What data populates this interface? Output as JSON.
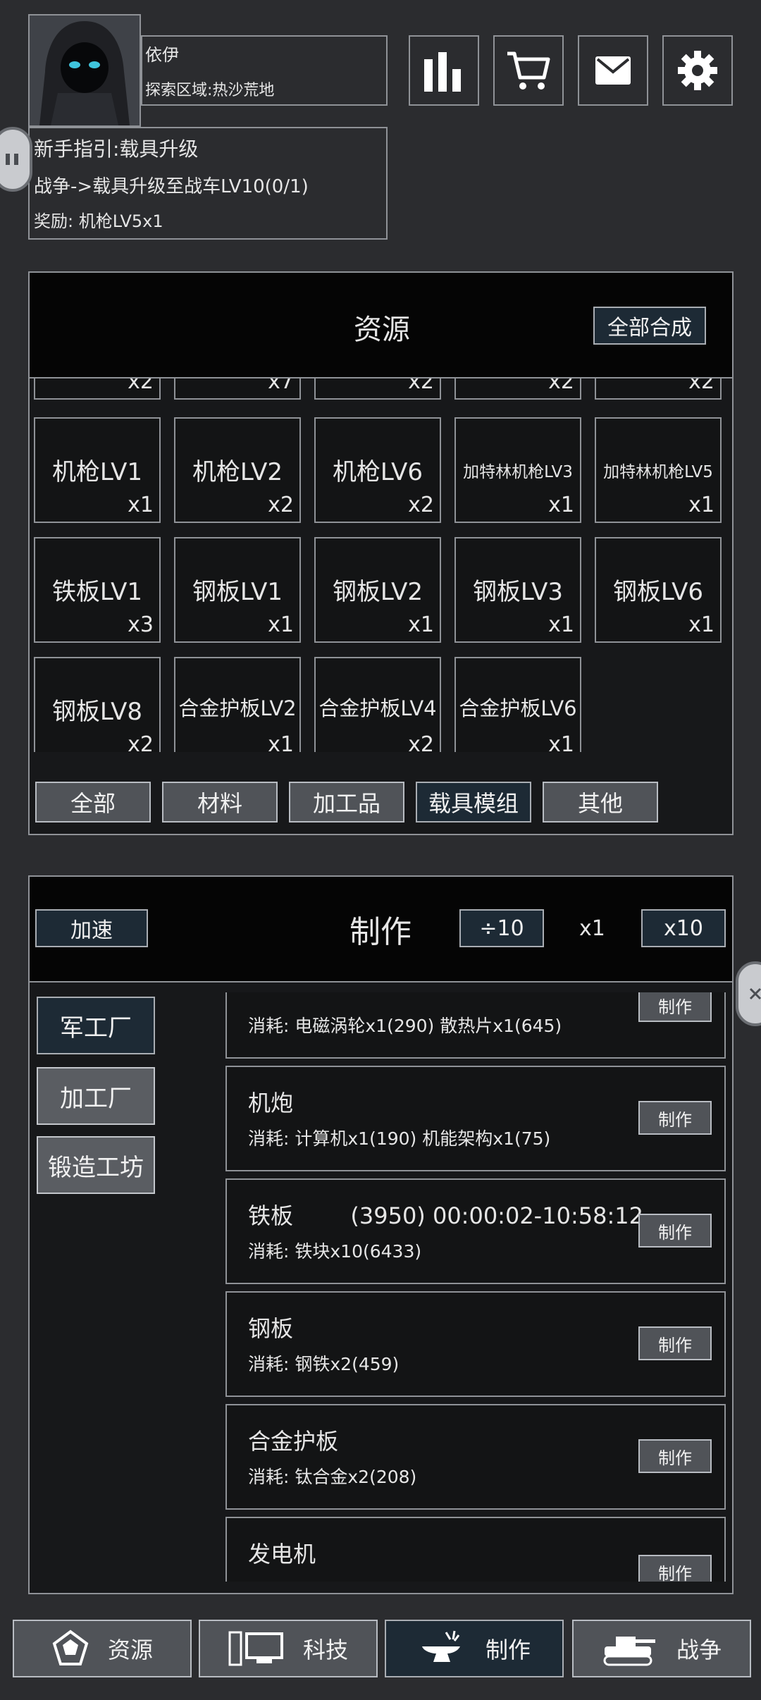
{
  "player": {
    "name": "依伊",
    "zone": "探索区域:热沙荒地"
  },
  "guide": {
    "title": "新手指引:载具升级",
    "task": "战争->载具升级至战车LV10(0/1)",
    "reward": "奖励: 机枪LV5x1"
  },
  "top_buttons": [
    {
      "icon": "bar-chart-icon"
    },
    {
      "icon": "cart-icon"
    },
    {
      "icon": "mail-icon"
    },
    {
      "icon": "gear-icon"
    }
  ],
  "resources": {
    "title": "资源",
    "merge_all": "全部合成",
    "partial_row": [
      "x2",
      "x7",
      "x2",
      "x2",
      "x2"
    ],
    "items": [
      {
        "name": "机枪LV1",
        "count": "x1"
      },
      {
        "name": "机枪LV2",
        "count": "x2"
      },
      {
        "name": "机枪LV6",
        "count": "x2"
      },
      {
        "name": "加特林机枪LV3",
        "count": "x1"
      },
      {
        "name": "加特林机枪LV5",
        "count": "x1"
      },
      {
        "name": "铁板LV1",
        "count": "x3"
      },
      {
        "name": "钢板LV1",
        "count": "x1"
      },
      {
        "name": "钢板LV2",
        "count": "x1"
      },
      {
        "name": "钢板LV3",
        "count": "x1"
      },
      {
        "name": "钢板LV6",
        "count": "x1"
      },
      {
        "name": "钢板LV8",
        "count": "x2"
      },
      {
        "name": "合金护板LV2",
        "count": "x1"
      },
      {
        "name": "合金护板LV4",
        "count": "x2"
      },
      {
        "name": "合金护板LV6",
        "count": "x1"
      }
    ],
    "tabs": [
      "全部",
      "材料",
      "加工品",
      "载具模组",
      "其他"
    ],
    "active_tab": 3
  },
  "craft": {
    "title": "制作",
    "speedup": "加速",
    "div10": "÷10",
    "multiplier": "x1",
    "mul10": "x10",
    "factories": [
      "军工厂",
      "加工厂",
      "锻造工坊"
    ],
    "active_factory": 0,
    "make_label": "制作",
    "recipes": [
      {
        "name": "",
        "cost": "消耗: 电磁涡轮x1(290) 散热片x1(645)"
      },
      {
        "name": "机炮",
        "cost": "消耗: 计算机x1(190) 机能架构x1(75)"
      },
      {
        "name": "铁板        (3950) 00:00:02-10:58:12",
        "cost": "消耗: 铁块x10(6433)"
      },
      {
        "name": "钢板",
        "cost": "消耗: 钢铁x2(459)"
      },
      {
        "name": "合金护板",
        "cost": "消耗: 钛合金x2(208)"
      },
      {
        "name": "发电机",
        "cost": ""
      }
    ]
  },
  "bottom_nav": [
    {
      "label": "资源",
      "icon": "dodecahedron-icon"
    },
    {
      "label": "科技",
      "icon": "computer-icon"
    },
    {
      "label": "制作",
      "icon": "anvil-icon"
    },
    {
      "label": "战争",
      "icon": "tank-icon"
    }
  ],
  "active_nav": 2
}
